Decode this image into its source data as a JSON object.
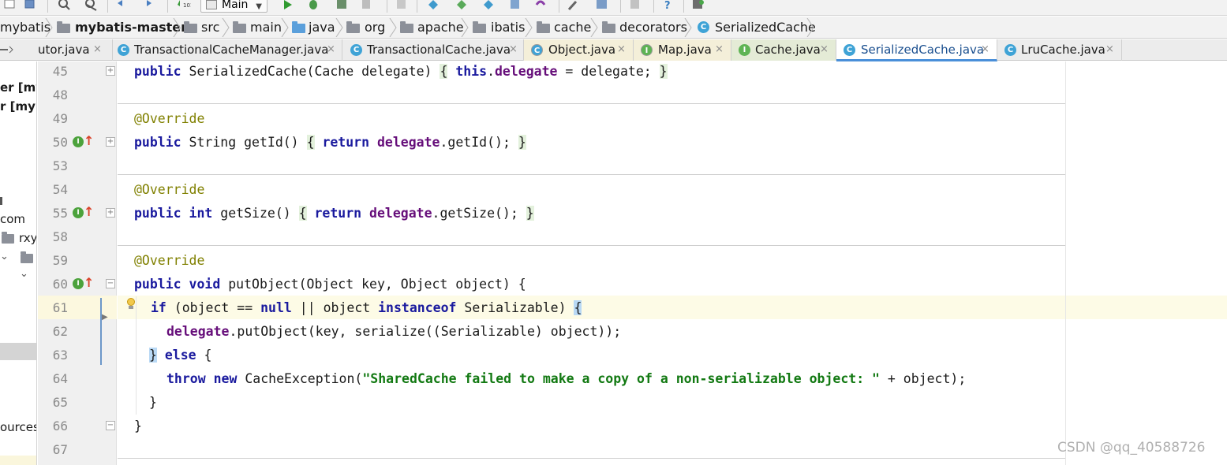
{
  "toolbar": {
    "run_config": "Main",
    "icons": [
      "open-icon",
      "save-icon",
      "find-icon",
      "replace-icon",
      "undo-icon",
      "redo-icon",
      "build-icon",
      "run-icon",
      "debug-icon",
      "coverage-icon",
      "profile-icon",
      "vcs-update-icon",
      "vcs-commit-icon",
      "vcs-compare-icon",
      "vcs-history-icon",
      "vcs-revert-icon",
      "settings-icon",
      "project-structure-icon",
      "download-icon",
      "help-icon",
      "sdk-icon"
    ]
  },
  "breadcrumb": [
    {
      "label": "mybatis",
      "bold": false
    },
    {
      "label": "mybatis-master",
      "bold": true
    },
    {
      "label": "src",
      "bold": false
    },
    {
      "label": "main",
      "bold": false
    },
    {
      "label": "java",
      "bold": false
    },
    {
      "label": "org",
      "bold": false
    },
    {
      "label": "apache",
      "bold": false
    },
    {
      "label": "ibatis",
      "bold": false
    },
    {
      "label": "cache",
      "bold": false
    },
    {
      "label": "decorators",
      "bold": false
    },
    {
      "label": "SerializedCache",
      "bold": false
    }
  ],
  "tabs": [
    {
      "label": "utor.java",
      "close": "×",
      "icon": "",
      "style": "plain"
    },
    {
      "label": "TransactionalCacheManager.java",
      "close": "×",
      "icon": "C",
      "style": "plain"
    },
    {
      "label": "TransactionalCache.java",
      "close": "×",
      "icon": "C",
      "style": "plain"
    },
    {
      "label": "Object.java",
      "close": "×",
      "icon": "C",
      "style": "yellow"
    },
    {
      "label": "Map.java",
      "close": "×",
      "icon": "I",
      "style": "yellow"
    },
    {
      "label": "Cache.java",
      "close": "×",
      "icon": "I",
      "style": "green"
    },
    {
      "label": "SerializedCache.java",
      "close": "×",
      "icon": "C",
      "style": "active"
    },
    {
      "label": "LruCache.java",
      "close": "×",
      "icon": "C",
      "style": "plain"
    }
  ],
  "project_panel": {
    "lines": [
      "er [my",
      "r [myb",
      "com",
      "rxy",
      "ources"
    ]
  },
  "editor": {
    "lines": [
      {
        "num": "45"
      },
      {
        "num": "48"
      },
      {
        "num": "49"
      },
      {
        "num": "50"
      },
      {
        "num": "53"
      },
      {
        "num": "54"
      },
      {
        "num": "55"
      },
      {
        "num": "58"
      },
      {
        "num": "59"
      },
      {
        "num": "60"
      },
      {
        "num": "61"
      },
      {
        "num": "62"
      },
      {
        "num": "63"
      },
      {
        "num": "64"
      },
      {
        "num": "65"
      },
      {
        "num": "66"
      },
      {
        "num": "67"
      }
    ],
    "code": {
      "l45_kw": "public",
      "l45_sig": " SerializedCache(Cache delegate) ",
      "l45_open": "{",
      "l45_this": "this",
      "l45_fld": "delegate",
      "l45_rest": " = delegate; ",
      "l45_close": "}",
      "override": "@Override",
      "l50_kw": "public",
      "l50_sig": " String getId() ",
      "l50_open": "{",
      "l50_ret": "return",
      "l50_fld": "delegate",
      "l50_rest": ".getId(); ",
      "l50_close": "}",
      "l55_kw": "public int",
      "l55_sig": " getSize() ",
      "l55_open": "{",
      "l55_ret": "return",
      "l55_fld": "delegate",
      "l55_rest": ".getSize(); ",
      "l55_close": "}",
      "l60_kw": "public void",
      "l60_sig": " putObject(Object key, Object object) {",
      "l61_if": "if",
      "l61_mid": " (object == ",
      "l61_null": "null",
      "l61_or": " || object ",
      "l61_inst": "instanceof",
      "l61_rest": " Serializable) ",
      "l61_brace": "{",
      "l62_fld": "delegate",
      "l62_rest": ".putObject(key, serialize((Serializable) object));",
      "l63_brace": "}",
      "l63_else": " else",
      "l63_rest": " {",
      "l64_throw": "throw new",
      "l64_cls": " CacheException(",
      "l64_str": "\"SharedCache failed to make a copy of a non-serializable object: \"",
      "l64_rest": " + object);",
      "l65": "}",
      "l66": "}"
    }
  },
  "watermark": "CSDN @qq_40588726"
}
